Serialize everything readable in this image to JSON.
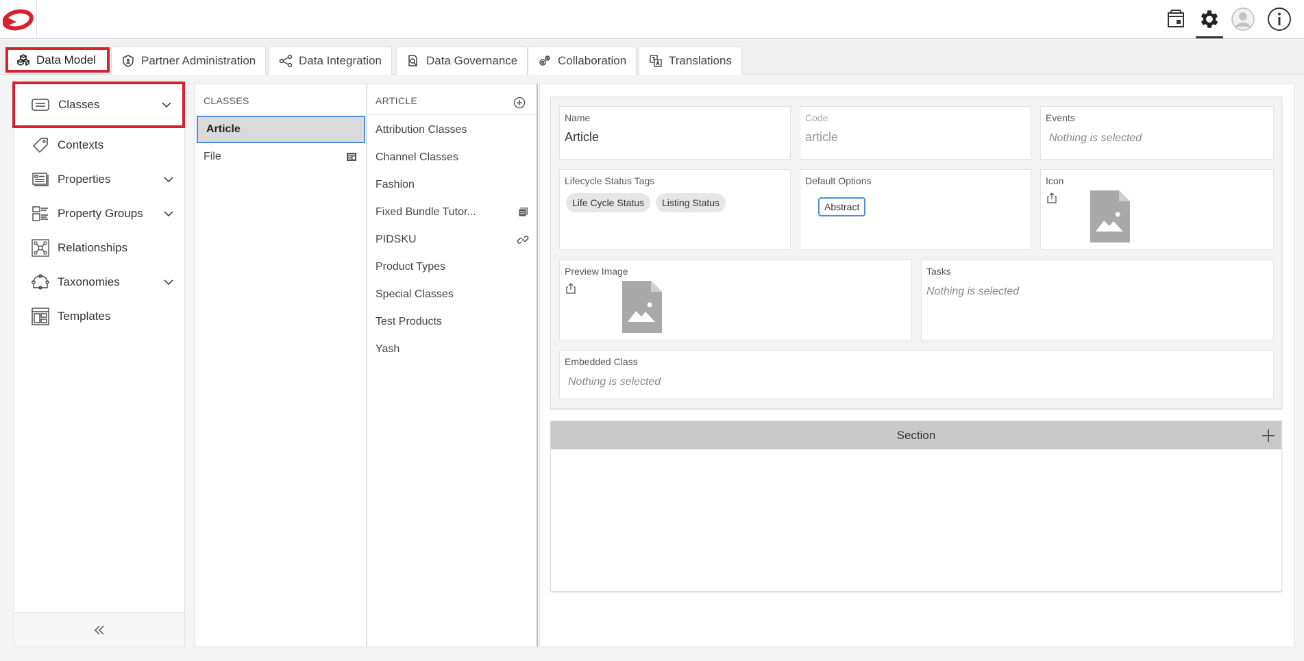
{
  "header": {
    "brand_color": "#d9202f",
    "icons": [
      "store-icon",
      "gear-icon",
      "user-avatar-icon",
      "info-icon"
    ]
  },
  "tabs": [
    {
      "label": "Data Model",
      "icon": "cubes-icon",
      "active": true
    },
    {
      "label": "Partner Administration",
      "icon": "shield-icon"
    },
    {
      "label": "Data Integration",
      "icon": "nodes-icon"
    },
    {
      "label": "Data Governance",
      "icon": "search-doc-icon"
    },
    {
      "label": "Collaboration",
      "icon": "gears-icon"
    },
    {
      "label": "Translations",
      "icon": "translate-icon"
    }
  ],
  "sidebar": {
    "items": [
      {
        "label": "Classes",
        "icon": "classes-icon",
        "expandable": true,
        "selected": true
      },
      {
        "label": "Contexts",
        "icon": "tag-icon",
        "expandable": false
      },
      {
        "label": "Properties",
        "icon": "properties-icon",
        "expandable": true
      },
      {
        "label": "Property Groups",
        "icon": "property-groups-icon",
        "expandable": true
      },
      {
        "label": "Relationships",
        "icon": "relationships-icon",
        "expandable": false
      },
      {
        "label": "Taxonomies",
        "icon": "taxonomies-icon",
        "expandable": true
      },
      {
        "label": "Templates",
        "icon": "templates-icon",
        "expandable": false
      }
    ]
  },
  "classes": {
    "header": "CLASSES",
    "items": [
      {
        "label": "Article",
        "selected": true
      },
      {
        "label": "File",
        "icon": "file-list-icon"
      }
    ]
  },
  "article": {
    "header": "ARTICLE",
    "items": [
      {
        "label": "Attribution Classes"
      },
      {
        "label": "Channel Classes"
      },
      {
        "label": "Fashion"
      },
      {
        "label": "Fixed Bundle Tutor...",
        "icon": "stack-icon"
      },
      {
        "label": "PIDSKU",
        "icon": "link-icon"
      },
      {
        "label": "Product Types"
      },
      {
        "label": "Special Classes"
      },
      {
        "label": "Test Products"
      },
      {
        "label": "Yash"
      }
    ]
  },
  "form": {
    "name_label": "Name",
    "name_value": "Article",
    "code_label": "Code",
    "code_value": "article",
    "events_label": "Events",
    "events_empty": "Nothing is selected",
    "lifecycle_label": "Lifecycle Status Tags",
    "lifecycle_tags": [
      "Life Cycle Status",
      "Listing Status"
    ],
    "default_options_label": "Default Options",
    "default_option": "Abstract",
    "icon_label": "Icon",
    "preview_label": "Preview Image",
    "tasks_label": "Tasks",
    "tasks_empty": "Nothing is selected",
    "embedded_label": "Embedded Class",
    "embedded_empty": "Nothing is selected"
  },
  "section": {
    "title": "Section"
  }
}
